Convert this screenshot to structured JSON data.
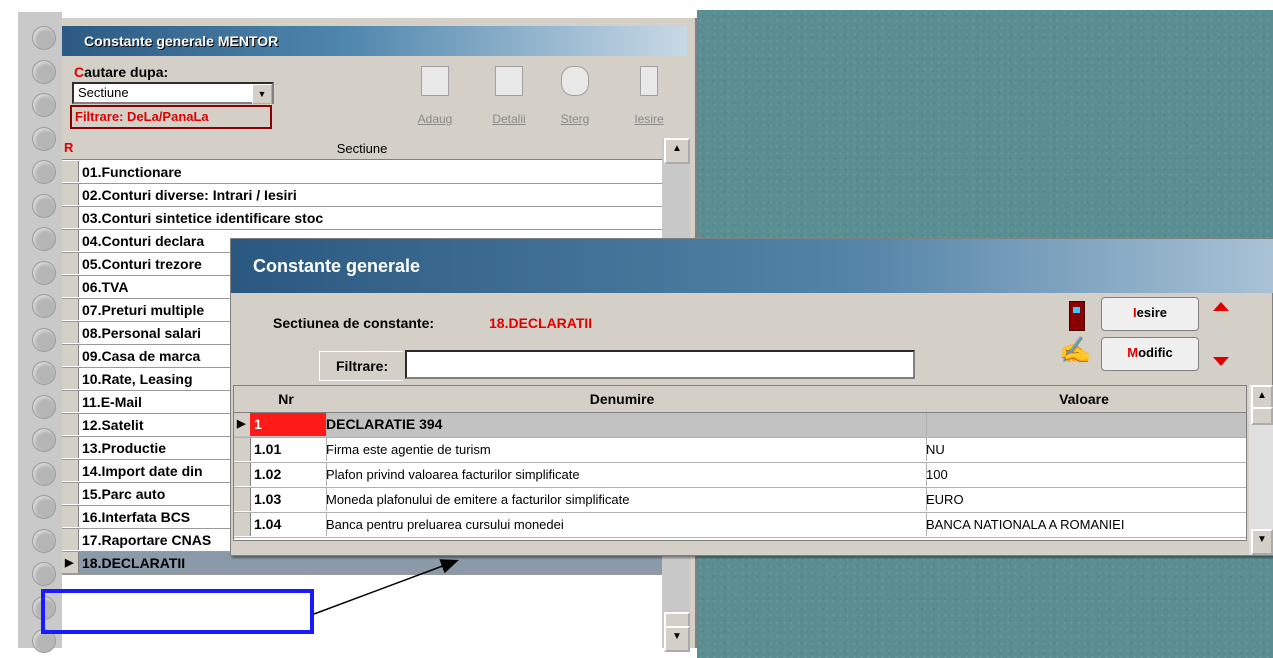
{
  "main": {
    "title": "Constante generale MENTOR",
    "search_label_first": "C",
    "search_label_rest": "autare dupa:",
    "search_value": "Sectiune",
    "filter_label": "Filtrare: DeLa/PanaLa",
    "toolbar": [
      {
        "label": "Adaug",
        "icon": "add-record-icon"
      },
      {
        "label": "Detalii",
        "icon": "details-icon"
      },
      {
        "label": "Sterg",
        "icon": "delete-icon"
      },
      {
        "label": "Iesire",
        "icon": "exit-door-icon"
      }
    ],
    "list_marker": "R",
    "list_header": "Sectiune",
    "sections": [
      "01.Functionare",
      "02.Conturi diverse: Intrari / Iesiri",
      "03.Conturi sintetice identificare stoc",
      "04.Conturi declara",
      "05.Conturi trezore",
      "06.TVA",
      "07.Preturi multiple",
      "08.Personal salari",
      "09.Casa de marca",
      "10.Rate, Leasing",
      "11.E-Mail",
      "12.Satelit",
      "13.Productie",
      "14.Import date din",
      "15.Parc auto",
      "16.Interfata BCS",
      "17.Raportare CNAS",
      "18.DECLARATII"
    ],
    "selected_section": "18.DECLARATII"
  },
  "dialog": {
    "title": "Constante generale",
    "section_label": "Sectiunea de constante:",
    "section_value": "18.DECLARATII",
    "filter_label": "Filtrare:",
    "filter_value": "",
    "exit_first": "I",
    "exit_rest": "esire",
    "modify_first": "M",
    "modify_rest": "odific",
    "columns": {
      "nr": "Nr",
      "denumire": "Denumire",
      "valoare": "Valoare"
    },
    "rows": [
      {
        "nr": "1",
        "denumire": "DECLARATIE 394",
        "valoare": "",
        "group": true
      },
      {
        "nr": "1.01",
        "denumire": "Firma este agentie de turism",
        "valoare": "NU"
      },
      {
        "nr": "1.02",
        "denumire": "Plafon privind valoarea facturilor simplificate",
        "valoare": "100"
      },
      {
        "nr": "1.03",
        "denumire": "Moneda plafonului de emitere a facturilor simplificate",
        "valoare": "EURO"
      },
      {
        "nr": "1.04",
        "denumire": "Banca pentru preluarea cursului monedei",
        "valoare": "BANCA NATIONALA A ROMANIEI"
      }
    ]
  },
  "colors": {
    "accent_red": "#e00000",
    "highlight_blue": "#1a1aff",
    "teal_background": "#5a8e93"
  }
}
